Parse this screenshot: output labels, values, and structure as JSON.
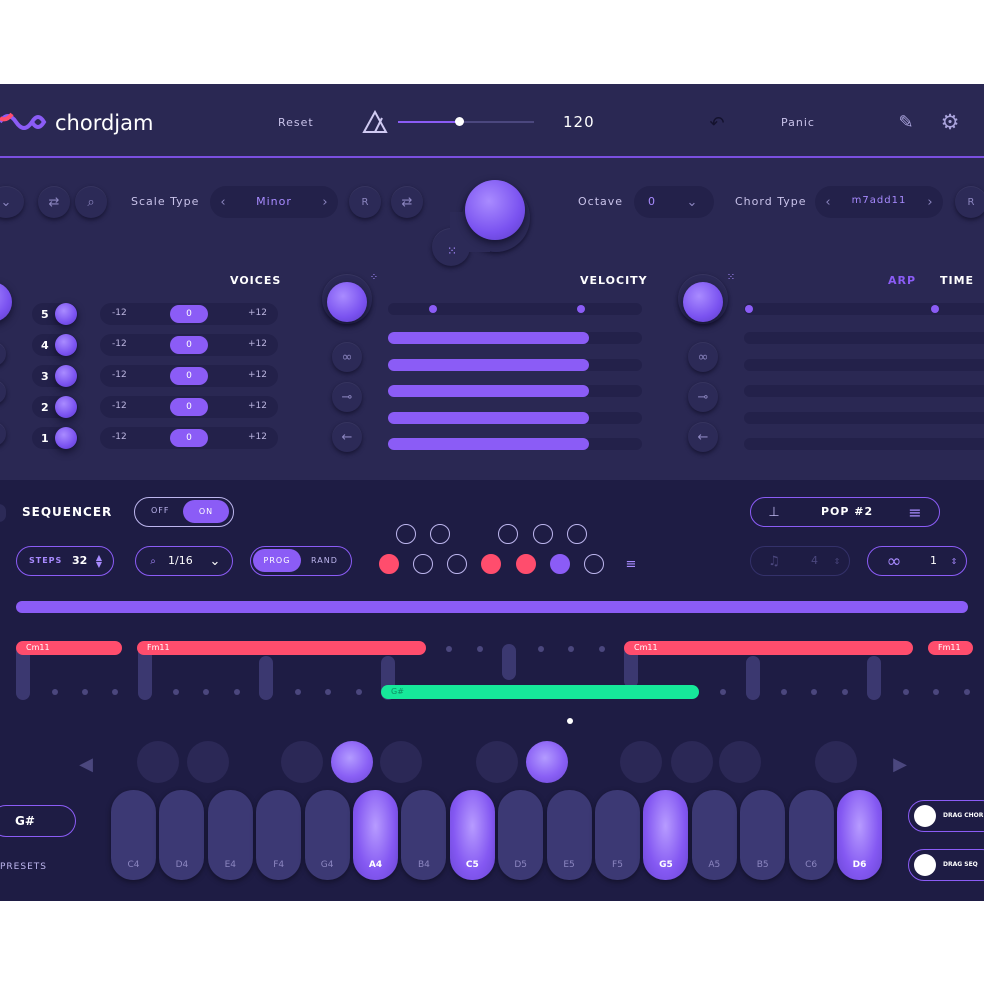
{
  "app": {
    "name": "chordjam"
  },
  "header": {
    "reset": "Reset",
    "tempo": "120",
    "tempo_fraction": 0.45,
    "panic": "Panic"
  },
  "controls": {
    "scale_type_label": "Scale Type",
    "scale_type": "Minor",
    "r": "R",
    "octave_label": "Octave",
    "octave": "0",
    "chord_type_label": "Chord Type",
    "chord_type": "m7add11"
  },
  "voices": {
    "title": "VOICES",
    "rows": [
      {
        "n": "5",
        "min": "-12",
        "val": "0",
        "max": "+12"
      },
      {
        "n": "4",
        "min": "-12",
        "val": "0",
        "max": "+12"
      },
      {
        "n": "3",
        "min": "-12",
        "val": "0",
        "max": "+12"
      },
      {
        "n": "2",
        "min": "-12",
        "val": "0",
        "max": "+12"
      },
      {
        "n": "1",
        "min": "-12",
        "val": "0",
        "max": "+12"
      }
    ]
  },
  "velocity": {
    "title": "VELOCITY",
    "bars": [
      0.79,
      0.79,
      0.79,
      0.79,
      0.79
    ]
  },
  "arp": {
    "arp": "ARP",
    "time": "TIME"
  },
  "sequencer": {
    "title": "SEQUENCER",
    "off": "OFF",
    "on": "ON",
    "steps_label": "STEPS",
    "steps": "32",
    "quantize": "1/16",
    "prog": "PROG",
    "rand": "RAND",
    "preset": "POP #2",
    "count": "4",
    "loops": "1"
  },
  "chords": [
    {
      "label": "Cm11",
      "color": "#ff4d6d"
    },
    {
      "label": "Fm11",
      "color": "#ff4d6d"
    },
    {
      "label": "G#",
      "color": "#16e89a"
    },
    {
      "label": "Cm11",
      "color": "#ff4d6d"
    },
    {
      "label": "Fm11",
      "color": "#ff4d6d"
    }
  ],
  "keys": [
    {
      "note": "C4",
      "on": false
    },
    {
      "note": "D4",
      "on": false
    },
    {
      "note": "E4",
      "on": false
    },
    {
      "note": "F4",
      "on": false
    },
    {
      "note": "G4",
      "on": false
    },
    {
      "note": "A4",
      "on": true
    },
    {
      "note": "B4",
      "on": false
    },
    {
      "note": "C5",
      "on": true
    },
    {
      "note": "D5",
      "on": false
    },
    {
      "note": "E5",
      "on": false
    },
    {
      "note": "F5",
      "on": false
    },
    {
      "note": "G5",
      "on": true
    },
    {
      "note": "A5",
      "on": false
    },
    {
      "note": "B5",
      "on": false
    },
    {
      "note": "C6",
      "on": false
    },
    {
      "note": "D6",
      "on": true
    }
  ],
  "bottom": {
    "key": "G#",
    "presets": "PRESETS",
    "drag_chord": "DRAG CHOR",
    "drag_seq": "DRAG SEQ"
  },
  "colors": {
    "bg": "#2a2853",
    "accent": "#8b5cf6",
    "red": "#ff4d6d",
    "green": "#16e89a"
  }
}
